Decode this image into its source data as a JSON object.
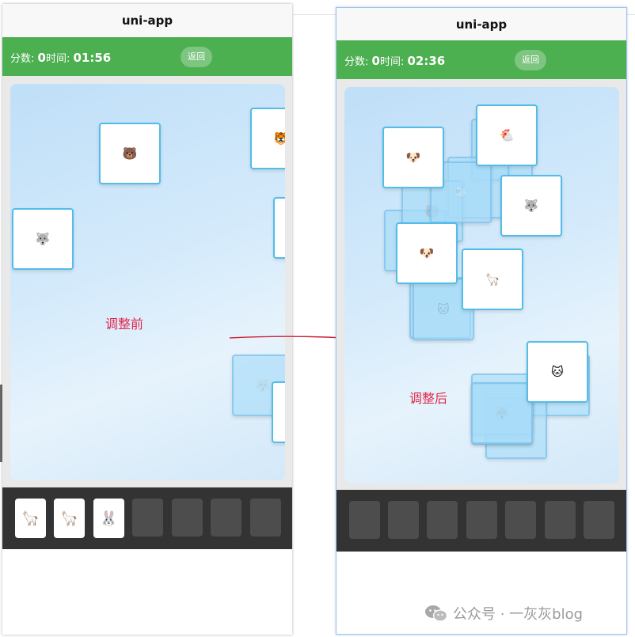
{
  "left_phone": {
    "title": "uni-app",
    "score_label": "分数:",
    "score_value": "0",
    "time_label": "时间:",
    "time_value": "01:56",
    "back_label": "返回",
    "annotation": "调整前",
    "board_tiles": [
      {
        "icon": "bear-icon",
        "glyph": "🐻",
        "covered": false
      },
      {
        "icon": "tiger-icon",
        "glyph": "🐯",
        "covered": false
      },
      {
        "icon": "wolf-icon",
        "glyph": "🐺",
        "covered": false
      },
      {
        "icon": "blank-tile",
        "glyph": "",
        "covered": false
      },
      {
        "icon": "wolf-icon",
        "glyph": "🐺",
        "covered": true
      },
      {
        "icon": "blank-tile",
        "glyph": "",
        "covered": false
      }
    ],
    "tray_slots": [
      {
        "icon": "llama-icon",
        "glyph": "🦙"
      },
      {
        "icon": "llama-icon",
        "glyph": "🦙"
      },
      {
        "icon": "rabbit-icon",
        "glyph": "🐰"
      },
      {
        "icon": "empty-slot",
        "glyph": ""
      },
      {
        "icon": "empty-slot",
        "glyph": ""
      },
      {
        "icon": "empty-slot",
        "glyph": ""
      },
      {
        "icon": "empty-slot",
        "glyph": ""
      }
    ]
  },
  "right_phone": {
    "title": "uni-app",
    "score_label": "分数:",
    "score_value": "0",
    "time_label": "时间:",
    "time_value": "02:36",
    "back_label": "返回",
    "annotation": "调整后",
    "board_tiles": [
      {
        "icon": "chicken-icon",
        "glyph": "🐔",
        "covered": false
      },
      {
        "icon": "dog-icon",
        "glyph": "🐶",
        "covered": false
      },
      {
        "icon": "sheep-icon",
        "glyph": "🐑",
        "covered": true
      },
      {
        "icon": "bear-icon",
        "glyph": "🐻",
        "covered": true
      },
      {
        "icon": "wolf-icon",
        "glyph": "🐺",
        "covered": false
      },
      {
        "icon": "dog-icon",
        "glyph": "🐶",
        "covered": false
      },
      {
        "icon": "llama-icon",
        "glyph": "🦙",
        "covered": false
      },
      {
        "icon": "cat-icon",
        "glyph": "🐱",
        "covered": true
      },
      {
        "icon": "cat-icon",
        "glyph": "🐱",
        "covered": false
      },
      {
        "icon": "wolf-icon",
        "glyph": "🐺",
        "covered": true
      },
      {
        "icon": "dog-icon",
        "glyph": "🐶",
        "covered": true
      },
      {
        "icon": "rabbit-icon",
        "glyph": "🐰",
        "covered": true
      }
    ],
    "tray_slots": [
      {
        "icon": "empty-slot",
        "glyph": ""
      },
      {
        "icon": "empty-slot",
        "glyph": ""
      },
      {
        "icon": "empty-slot",
        "glyph": ""
      },
      {
        "icon": "empty-slot",
        "glyph": ""
      },
      {
        "icon": "empty-slot",
        "glyph": ""
      },
      {
        "icon": "empty-slot",
        "glyph": ""
      },
      {
        "icon": "empty-slot",
        "glyph": ""
      }
    ]
  },
  "watermark": "公众号 · 一灰灰blog",
  "colors": {
    "header_green": "#4caf50",
    "tray_dark": "#333333",
    "tile_border": "#52bde8",
    "annotation_red": "#e0284a"
  }
}
